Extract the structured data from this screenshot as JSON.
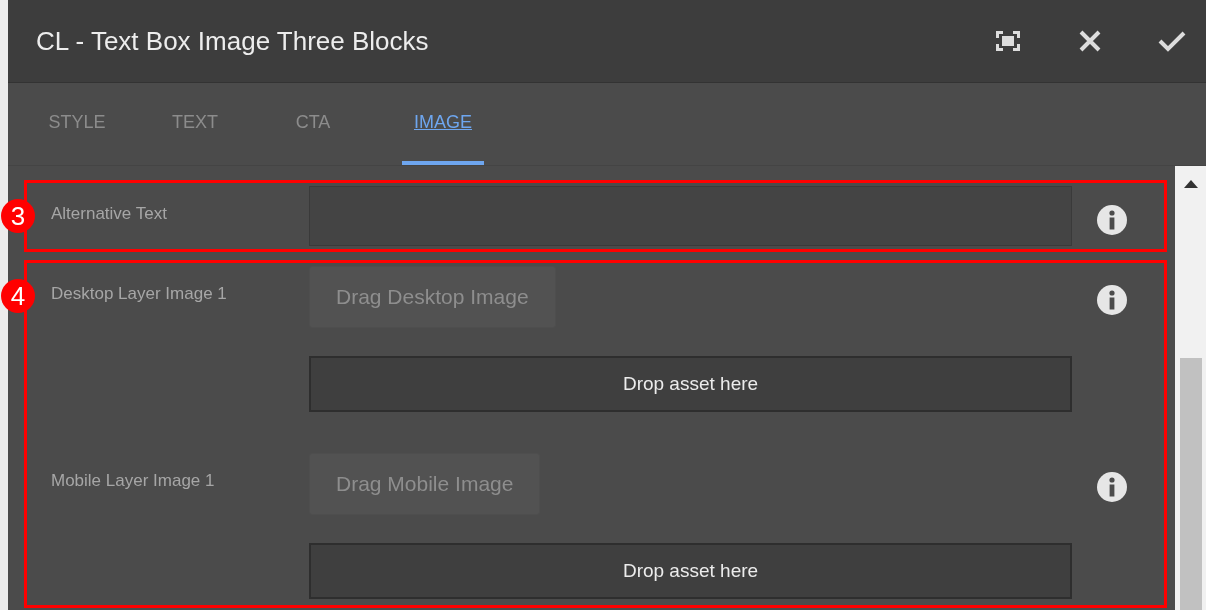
{
  "window": {
    "title": "CL - Text Box Image Three Blocks"
  },
  "tabs": [
    {
      "label": "STYLE",
      "selected": false
    },
    {
      "label": "TEXT",
      "selected": false
    },
    {
      "label": "CTA",
      "selected": false
    },
    {
      "label": "IMAGE",
      "selected": true
    }
  ],
  "sections": [
    {
      "badge": "3",
      "fields": [
        {
          "kind": "text",
          "label": "Alternative Text"
        }
      ]
    },
    {
      "badge": "4",
      "fields": [
        {
          "kind": "image",
          "label": "Desktop Layer Image 1",
          "drag_button": "Drag Desktop Image",
          "drop_zone": "Drop asset here"
        },
        {
          "kind": "image",
          "label": "Mobile Layer Image 1",
          "drag_button": "Drag Mobile Image",
          "drop_zone": "Drop asset here"
        }
      ]
    }
  ]
}
